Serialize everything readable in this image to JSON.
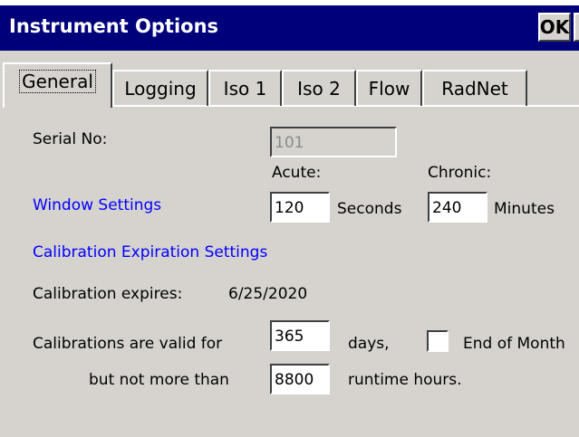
{
  "window": {
    "title": "Instrument Options"
  },
  "titlebar": {
    "ok_label": "OK",
    "close_label": "×"
  },
  "tabs": [
    {
      "label": "General",
      "active": true
    },
    {
      "label": "Logging"
    },
    {
      "label": "Iso 1"
    },
    {
      "label": "Iso 2"
    },
    {
      "label": "Flow"
    },
    {
      "label": "RadNet"
    }
  ],
  "general": {
    "serial_label": "Serial No:",
    "serial_value": "101",
    "acute_label": "Acute:",
    "chronic_label": "Chronic:",
    "window_settings_link": "Window Settings",
    "acute_value": "120",
    "seconds_label": "Seconds",
    "chronic_value": "240",
    "minutes_label": "Minutes",
    "calibration_link": "Calibration Expiration Settings",
    "expires_label": "Calibration expires:",
    "expires_value": "6/25/2020",
    "valid_for_label": "Calibrations are valid for",
    "valid_days_value": "365",
    "days_label": "days,",
    "end_of_month_label": "End of Month",
    "end_of_month_checked": false,
    "not_more_than_label": "but not more than",
    "runtime_value": "8800",
    "runtime_label": "runtime hours."
  }
}
